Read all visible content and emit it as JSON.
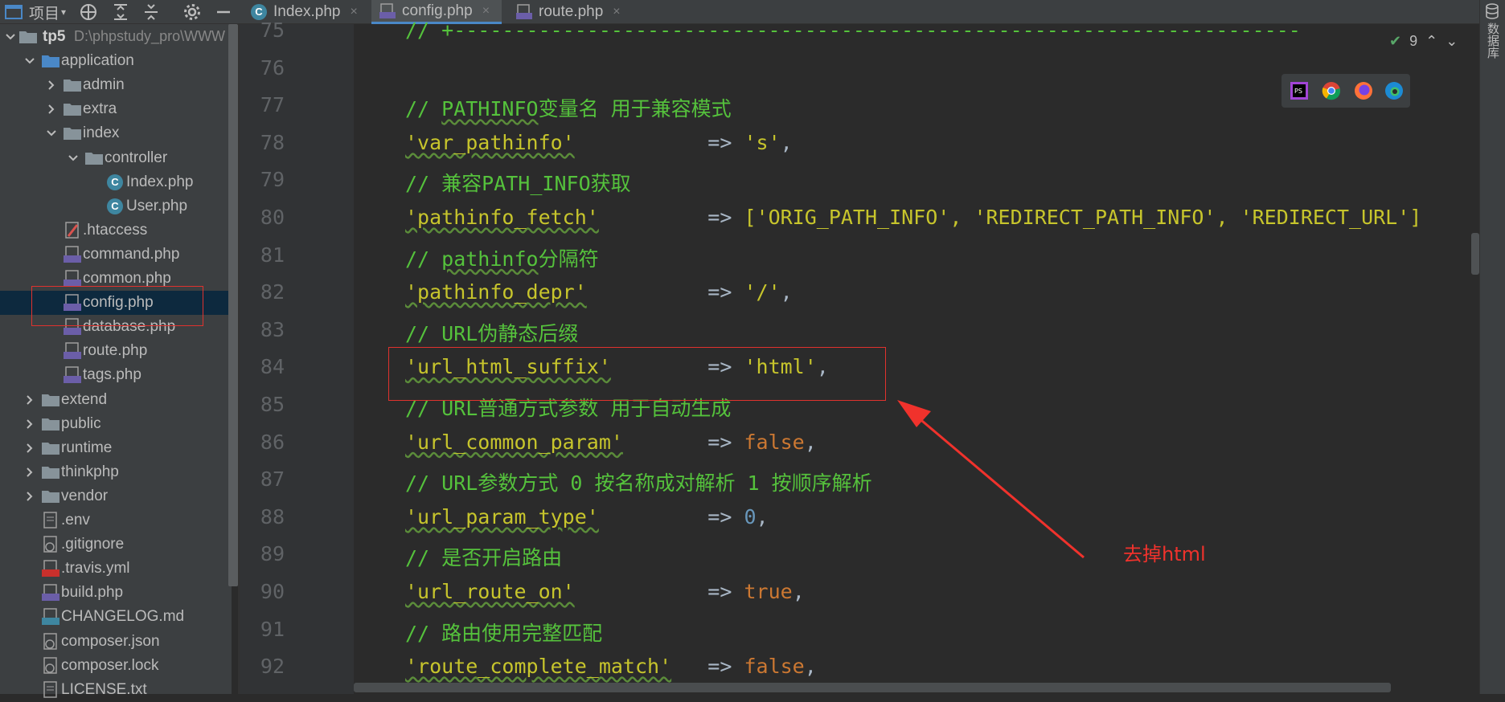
{
  "toolbar": {
    "project_label": "项目",
    "tabs": [
      {
        "label": "Index.php",
        "icon": "c-class-icon",
        "active": false
      },
      {
        "label": "config.php",
        "icon": "php-file-icon",
        "active": true
      },
      {
        "label": "route.php",
        "icon": "php-file-icon",
        "active": false
      }
    ],
    "close_glyph": "×"
  },
  "project_tree": {
    "root_name": "tp5",
    "root_path": "D:\\phpstudy_pro\\WWW",
    "items": [
      {
        "label": "application",
        "type": "folder",
        "expanded": true
      },
      {
        "label": "admin",
        "type": "folder",
        "expanded": false
      },
      {
        "label": "extra",
        "type": "folder",
        "expanded": false
      },
      {
        "label": "index",
        "type": "folder",
        "expanded": true
      },
      {
        "label": "controller",
        "type": "folder",
        "expanded": true
      },
      {
        "label": "Index.php",
        "type": "class"
      },
      {
        "label": "User.php",
        "type": "class"
      },
      {
        "label": ".htaccess",
        "type": "htaccess"
      },
      {
        "label": "command.php",
        "type": "php"
      },
      {
        "label": "common.php",
        "type": "php"
      },
      {
        "label": "config.php",
        "type": "php",
        "selected": true
      },
      {
        "label": "database.php",
        "type": "php"
      },
      {
        "label": "route.php",
        "type": "php"
      },
      {
        "label": "tags.php",
        "type": "php"
      },
      {
        "label": "extend",
        "type": "folder",
        "expanded": false
      },
      {
        "label": "public",
        "type": "folder",
        "expanded": false
      },
      {
        "label": "runtime",
        "type": "folder",
        "expanded": false
      },
      {
        "label": "thinkphp",
        "type": "folder",
        "expanded": false
      },
      {
        "label": "vendor",
        "type": "folder",
        "expanded": false
      },
      {
        "label": ".env",
        "type": "text"
      },
      {
        "label": ".gitignore",
        "type": "gitignore"
      },
      {
        "label": ".travis.yml",
        "type": "yml"
      },
      {
        "label": "build.php",
        "type": "php"
      },
      {
        "label": "CHANGELOG.md",
        "type": "md"
      },
      {
        "label": "composer.json",
        "type": "json"
      },
      {
        "label": "composer.lock",
        "type": "lock"
      },
      {
        "label": "LICENSE.txt",
        "type": "text"
      }
    ]
  },
  "editor": {
    "inspections_count": "9",
    "lines": [
      {
        "no": "75",
        "code": "// +----------------------------------------------------------------------"
      },
      {
        "no": "76",
        "code": ""
      },
      {
        "no": "77",
        "comment": "// ",
        "comment_word": "PATHINFO",
        "comment_rest": "变量名 用于兼容模式"
      },
      {
        "no": "78",
        "key": "'var_pathinfo'",
        "pad": "           ",
        "op": "=>",
        "value": "'s'",
        "value_type": "str",
        "tail": ","
      },
      {
        "no": "79",
        "comment": "// 兼容PATH_INFO获取"
      },
      {
        "no": "80",
        "key": "'pathinfo_fetch'",
        "pad": "         ",
        "op": "=>",
        "value": "['ORIG_PATH_INFO', 'REDIRECT_PATH_INFO', 'REDIRECT_URL']",
        "value_type": "str",
        "tail": ""
      },
      {
        "no": "81",
        "comment": "// ",
        "comment_word": "pathinfo",
        "comment_rest": "分隔符"
      },
      {
        "no": "82",
        "key": "'pathinfo_depr'",
        "pad": "          ",
        "op": "=>",
        "value": "'/'",
        "value_type": "str",
        "tail": ","
      },
      {
        "no": "83",
        "comment": "// URL伪静态后缀"
      },
      {
        "no": "84",
        "key": "'url_html_suffix'",
        "pad": "        ",
        "op": "=>",
        "value": "'html'",
        "value_type": "str",
        "tail": ","
      },
      {
        "no": "85",
        "comment": "// URL普通方式参数 用于自动生成"
      },
      {
        "no": "86",
        "key": "'url_common_param'",
        "pad": "       ",
        "op": "=>",
        "value": "false",
        "value_type": "kw",
        "tail": ","
      },
      {
        "no": "87",
        "comment": "// URL参数方式 0 按名称成对解析 1 按顺序解析"
      },
      {
        "no": "88",
        "key": "'url_param_type'",
        "pad": "         ",
        "op": "=>",
        "value": "0",
        "value_type": "num",
        "tail": ","
      },
      {
        "no": "89",
        "comment": "// 是否开启路由"
      },
      {
        "no": "90",
        "key": "'url_route_on'",
        "pad": "           ",
        "op": "=>",
        "value": "true",
        "value_type": "kw",
        "tail": ","
      },
      {
        "no": "91",
        "comment": "// 路由使用完整匹配"
      },
      {
        "no": "92",
        "key": "'route_complete_match'",
        "pad": "   ",
        "op": "=>",
        "value": "false",
        "value_type": "kw",
        "tail": ","
      }
    ]
  },
  "right_panel": {
    "label": "数据库"
  },
  "annotation": {
    "text": "去掉html",
    "color": "#f0322c"
  },
  "colors": {
    "comment": "#55c23c",
    "string": "#c7c52c",
    "keyword": "#cc7832",
    "number": "#6897bb",
    "line_number": "#606366",
    "selection": "#0d293e",
    "highlight_box": "#e0322e"
  }
}
